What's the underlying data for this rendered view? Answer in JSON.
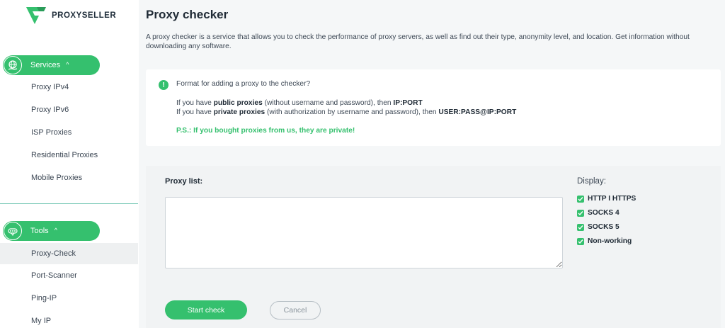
{
  "brand": {
    "name": "PROXYSELLER",
    "color": "#35c06e"
  },
  "sidebar": {
    "services_label": "Services",
    "services_items": [
      {
        "label": "Proxy IPv4"
      },
      {
        "label": "Proxy IPv6"
      },
      {
        "label": "ISP Proxies"
      },
      {
        "label": "Residential Proxies"
      },
      {
        "label": "Mobile Proxies"
      }
    ],
    "tools_label": "Tools",
    "tools_items": [
      {
        "label": "Proxy-Check",
        "active": true
      },
      {
        "label": "Port-Scanner"
      },
      {
        "label": "Ping-IP"
      },
      {
        "label": "My IP"
      }
    ]
  },
  "main": {
    "title": "Proxy checker",
    "description": "A proxy checker is a service that allows you to check the performance of proxy servers, as well as find out their type, anonymity level, and location. Get information without downloading any software.",
    "info": {
      "icon": "exclamation-icon",
      "heading": "Format for adding a proxy to the checker?",
      "public_prefix": "If you have ",
      "public_strong": "public proxies",
      "public_middle": " (without username and password), then ",
      "public_format": "IP:PORT",
      "private_prefix": "If you have ",
      "private_strong": "private proxies",
      "private_middle": " (with authorization by username and password), then ",
      "private_format": "USER:PASS@IP:PORT",
      "ps": "P.S.: If you bought proxies from us, they are private!"
    },
    "form": {
      "proxy_list_label": "Proxy list:",
      "proxy_list_value": "",
      "display_label": "Display:",
      "options": [
        {
          "label": "HTTP I HTTPS",
          "checked": true
        },
        {
          "label": "SOCKS 4",
          "checked": true
        },
        {
          "label": "SOCKS 5",
          "checked": true
        },
        {
          "label": "Non-working",
          "checked": true
        }
      ],
      "start_label": "Start check",
      "cancel_label": "Cancel"
    }
  }
}
